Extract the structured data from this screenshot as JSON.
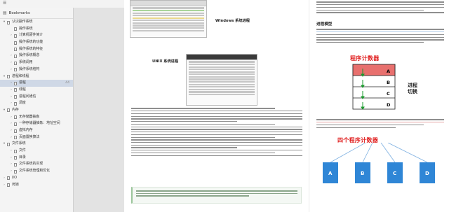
{
  "sidebar": {
    "title": "Bookmarks",
    "items": [
      {
        "label": "认识操作系统",
        "page": "",
        "level": 0,
        "open": true
      },
      {
        "label": "操作系统",
        "page": "",
        "level": 1
      },
      {
        "label": "计算机硬件简介",
        "page": "",
        "level": 1,
        "collapsed": true
      },
      {
        "label": "操作系统的功能",
        "page": "",
        "level": 1
      },
      {
        "label": "操作系统的特征",
        "page": "",
        "level": 1
      },
      {
        "label": "操作系统概念",
        "page": "",
        "level": 1,
        "collapsed": true
      },
      {
        "label": "系统调用",
        "page": "",
        "level": 1,
        "collapsed": true
      },
      {
        "label": "操作系统结构",
        "page": "",
        "level": 1,
        "collapsed": true
      },
      {
        "label": "进程和线程",
        "page": "",
        "level": 0,
        "open": true
      },
      {
        "label": "进程",
        "page": "44",
        "level": 1,
        "collapsed": true,
        "selected": true
      },
      {
        "label": "线程",
        "page": "",
        "level": 1,
        "collapsed": true
      },
      {
        "label": "进程间通信",
        "page": "",
        "level": 1,
        "collapsed": true
      },
      {
        "label": "调度",
        "page": "",
        "level": 1,
        "collapsed": true
      },
      {
        "label": "内存",
        "page": "",
        "level": 0,
        "open": true
      },
      {
        "label": "无存储器抽象",
        "page": "",
        "level": 1,
        "collapsed": true
      },
      {
        "label": "一种存储器抽象：地址空间",
        "page": "",
        "level": 1,
        "collapsed": true
      },
      {
        "label": "虚拟内存",
        "page": "",
        "level": 1,
        "collapsed": true
      },
      {
        "label": "页面置换算法",
        "page": "",
        "level": 1,
        "collapsed": true
      },
      {
        "label": "文件系统",
        "page": "",
        "level": 0,
        "open": true
      },
      {
        "label": "文件",
        "page": "",
        "level": 1,
        "collapsed": true
      },
      {
        "label": "目录",
        "page": "",
        "level": 1,
        "collapsed": true
      },
      {
        "label": "文件系统的实现",
        "page": "",
        "level": 1,
        "collapsed": true
      },
      {
        "label": "文件系统管理和优化",
        "page": "",
        "level": 1,
        "collapsed": true
      },
      {
        "label": "I/O",
        "page": "",
        "level": 0,
        "collapsed": true
      },
      {
        "label": "死锁",
        "page": "",
        "level": 0,
        "collapsed": true
      }
    ]
  },
  "document": {
    "windows_caption": "Windows 系统进程",
    "unix_caption": "UNIX 系统进程",
    "model_heading": "进程模型",
    "pc_title": "程序计数器",
    "pc_processes": [
      "A",
      "B",
      "C",
      "D"
    ],
    "process_switch": "进程\n切换",
    "four_pc_title": "四个程序计数器",
    "four_pc_processes": [
      "A",
      "B",
      "C",
      "D"
    ]
  },
  "colors": {
    "accent": "#e02020",
    "box": "#2f86d6",
    "selected": "#cfd8e6"
  }
}
